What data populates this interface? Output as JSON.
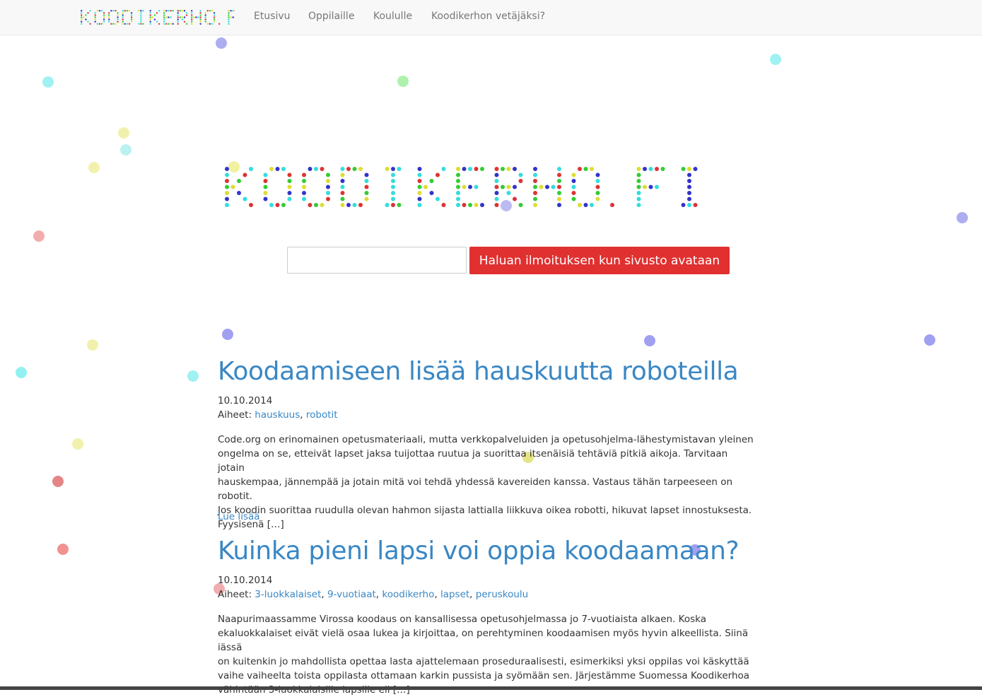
{
  "nav": {
    "brand": "KOODIKERHO.FI",
    "items": [
      "Etusivu",
      "Oppilaille",
      "Koululle",
      "Koodikerhon vetäjäksi?"
    ]
  },
  "hero": {
    "logo_text": "KOODIKERHO.FI",
    "email_placeholder": "",
    "notify_button": "Haluan ilmoituksen kun sivusto avataan"
  },
  "posts": [
    {
      "title": "Koodaamiseen lisää hauskuutta roboteilla",
      "date": "10.10.2014",
      "tags_label": "Aiheet:",
      "tags": [
        "hauskuus",
        "robotit"
      ],
      "excerpt_lines": [
        "Code.org on erinomainen opetusmateriaali, mutta verkkopalveluiden ja opetusohjelma-lähestymistavan yleinen",
        "ongelma on se, etteivät lapset jaksa tuijottaa ruutua ja suorittaa itsenäisiä tehtäviä pitkiä aikoja. Tarvitaan jotain",
        "hauskempaa, jännempää ja jotain mitä voi tehdä yhdessä kavereiden kanssa. Vastaus tähän tarpeeseen on robotit.",
        "Jos koodin suorittaa ruudulla olevan hahmon sijasta lattialla liikkuva oikea robotti, hikuvat lapset innostuksesta.",
        "Fyysisenä […]"
      ],
      "read_more": "Lue lisää"
    },
    {
      "title": "Kuinka pieni lapsi voi oppia koodaamaan?",
      "date": "10.10.2014",
      "tags_label": "Aiheet:",
      "tags": [
        "3-luokkalaiset",
        "9-vuotiaat",
        "koodikerho",
        "lapset",
        "peruskoulu"
      ],
      "excerpt_lines": [
        "Naapurimaassamme Virossa koodaus on kansallisessa opetusohjelmassa jo 7-vuotiaista alkaen. Koska",
        "ekaluokkalaiset eivät vielä osaa lukea ja kirjoittaa, on perehtyminen koodaamisen myös hyvin alkeellista. Siinä iässä",
        "on kuitenkin jo mahdollista opettaa lasta ajattelemaan proseduraalisesti, esimerkiksi yksi oppilas voi käskyttää",
        "vaihe vaiheelta toista oppilasta ottamaan karkin pussista ja syömään sen. Järjestämme Suomessa Koodikerhoa",
        "vähintään 3-luokkalaisille lapsille eli […]"
      ]
    }
  ],
  "colors": {
    "accent_link": "#3a87c4",
    "button_red": "#e03030",
    "dot_palette": [
      "#3333cc",
      "#33cc33",
      "#33dddd",
      "#dddd33",
      "#dd3333"
    ]
  }
}
